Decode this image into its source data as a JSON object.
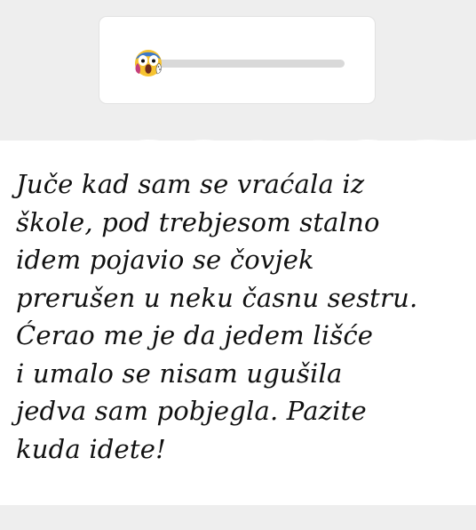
{
  "slider": {
    "value": 0.07,
    "thumb_icon": "shocked-screaming-emoji-icon",
    "track_color": "#d9d9d9",
    "fill_color": "#8a8a8a"
  },
  "note": {
    "lines": [
      "Juče kad sam se vraćala iz",
      "škole, pod trebjesom stalno",
      "idem pojavio se čovjek",
      "prerušen u neku časnu sestru.",
      "Ćerao me je da jedem lišće",
      "i umalo se nisam ugušila",
      "jedva sam pobjegla. Pazite",
      "kuda idete!"
    ],
    "text_color": "#111111"
  }
}
